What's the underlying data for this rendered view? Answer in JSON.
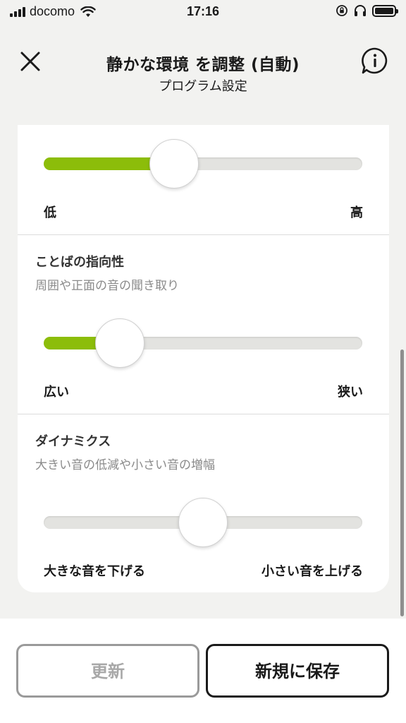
{
  "status_bar": {
    "carrier": "docomo",
    "time": "17:16"
  },
  "header": {
    "title": "静かな環境 を調整 (自動)",
    "subtitle": "プログラム設定"
  },
  "sliders": [
    {
      "title": "",
      "description": "",
      "min_label": "低",
      "max_label": "高",
      "value_percent": 41
    },
    {
      "title": "ことばの指向性",
      "description": "周囲や正面の音の聞き取り",
      "min_label": "広い",
      "max_label": "狭い",
      "value_percent": 24
    },
    {
      "title": "ダイナミクス",
      "description": "大きい音の低減や小さい音の増幅",
      "min_label": "大きな音を下げる",
      "max_label": "小さい音を上げる",
      "value_percent": 50
    }
  ],
  "buttons": {
    "update_label": "更新",
    "save_new_label": "新規に保存"
  },
  "colors": {
    "accent": "#8cbd0a",
    "background": "#f2f2f0"
  }
}
